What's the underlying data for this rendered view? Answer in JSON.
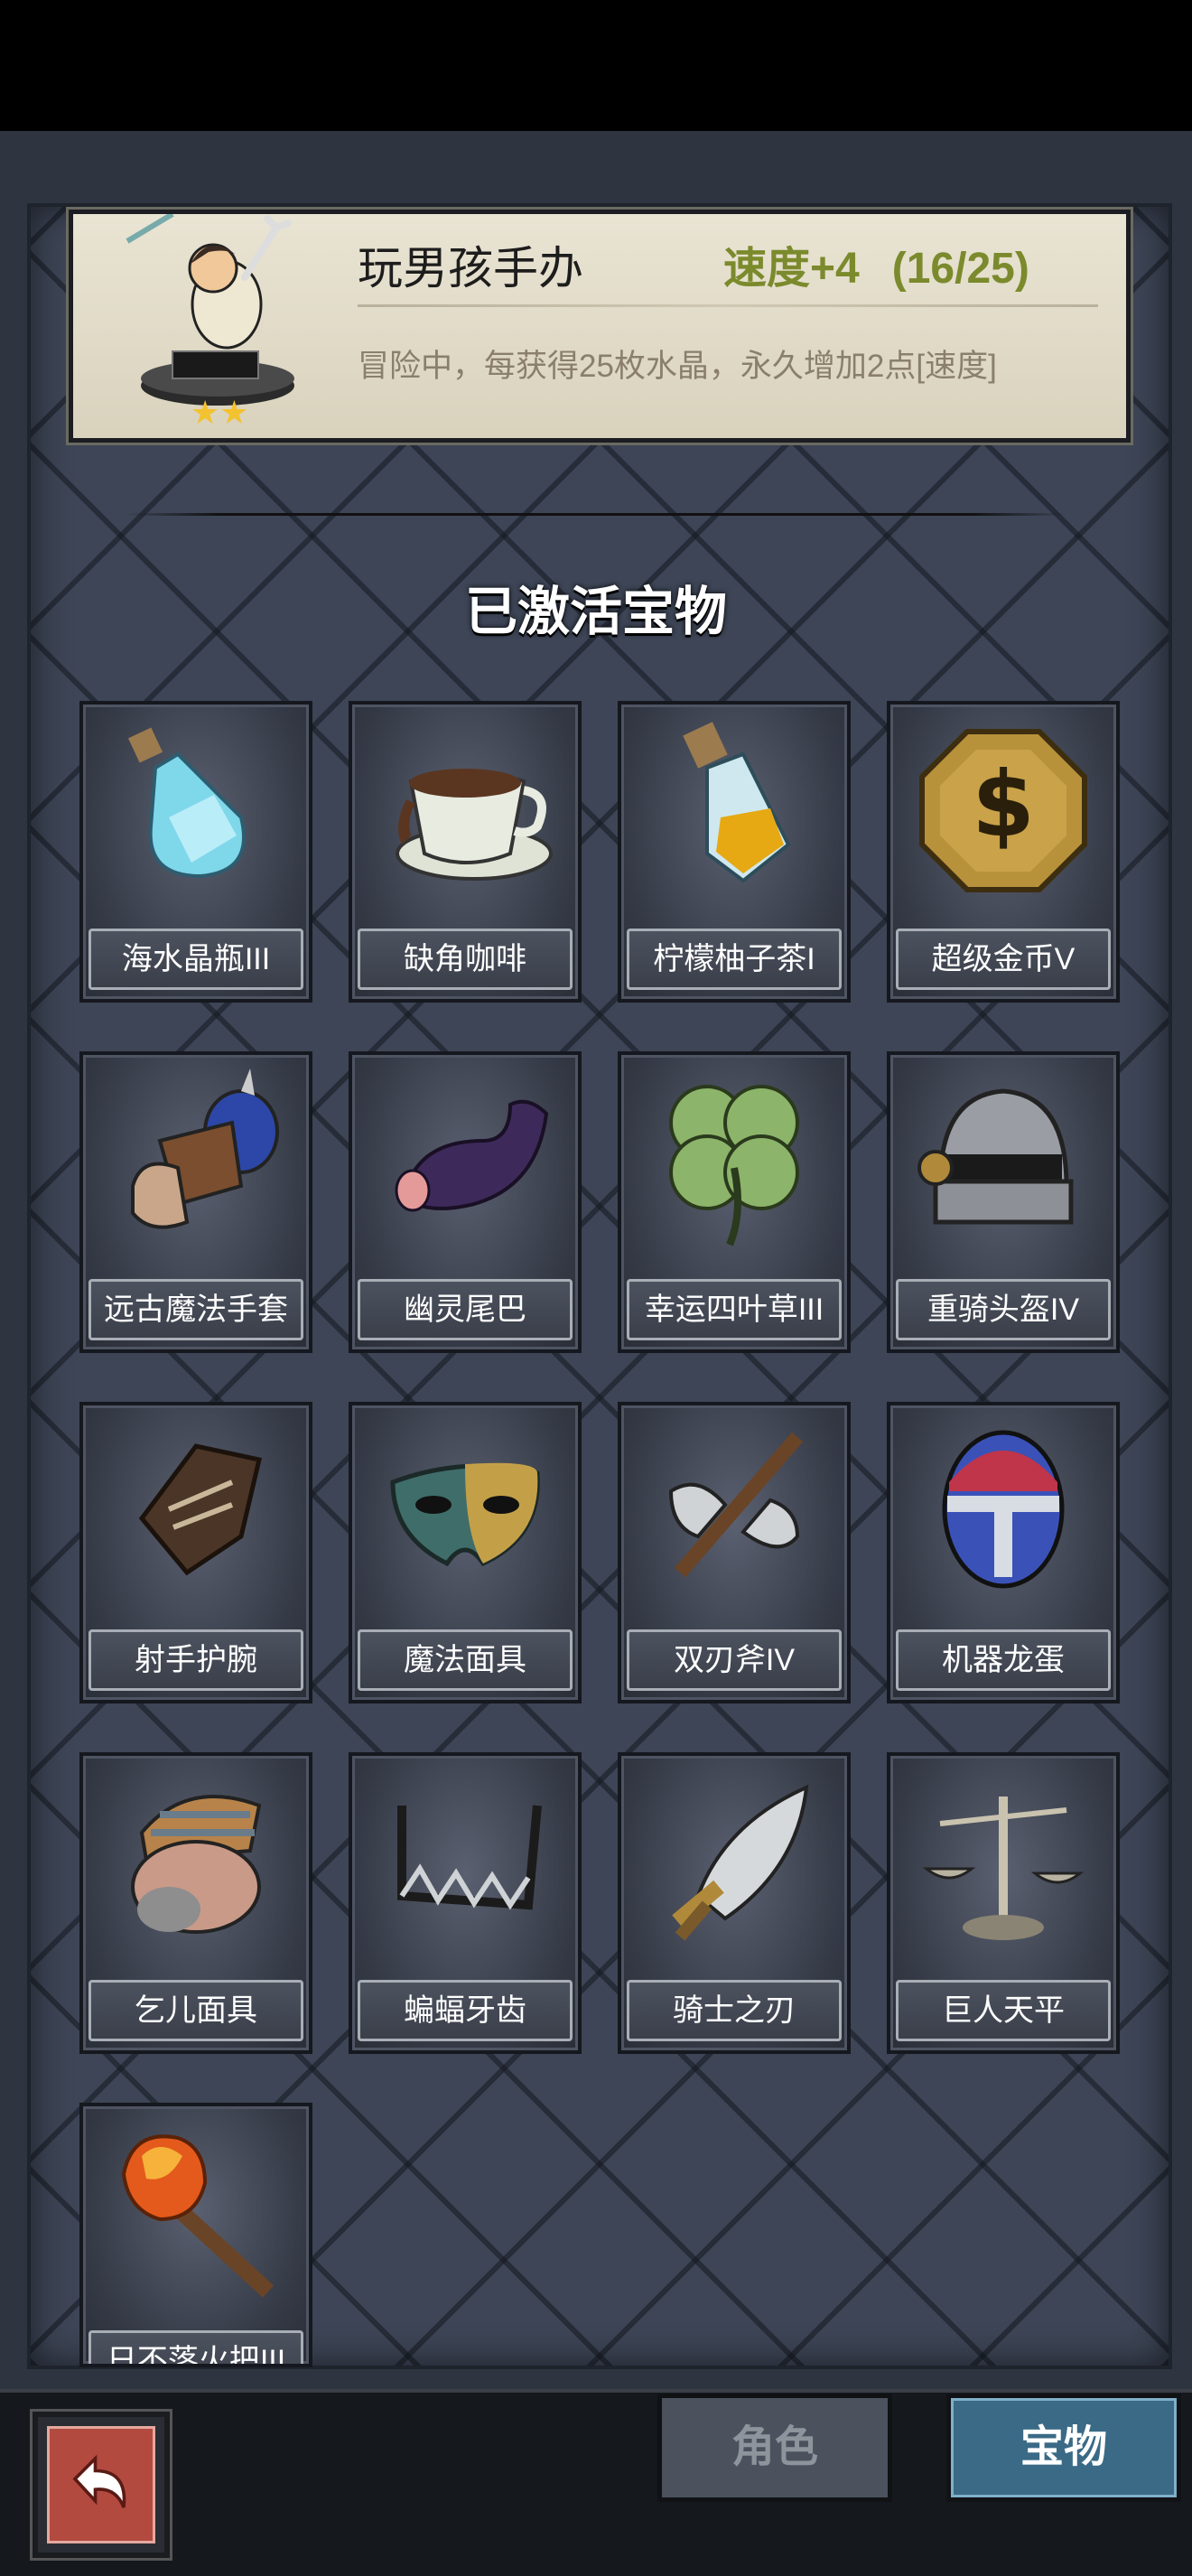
{
  "featured": {
    "name": "玩男孩手办",
    "bonus": "速度+4",
    "progress": "(16/25)",
    "description": "冒险中，每获得25枚水晶，永久增加2点[速度]",
    "stars": 2
  },
  "section_title": "已激活宝物",
  "treasures": [
    {
      "name": "海水晶瓶III",
      "icon": "crystal-bottle-icon"
    },
    {
      "name": "缺角咖啡",
      "icon": "chipped-coffee-icon"
    },
    {
      "name": "柠檬柚子茶I",
      "icon": "lemon-tea-icon"
    },
    {
      "name": "超级金币V",
      "icon": "gold-coin-icon"
    },
    {
      "name": "远古魔法手套",
      "icon": "magic-glove-icon"
    },
    {
      "name": "幽灵尾巴",
      "icon": "ghost-tail-icon"
    },
    {
      "name": "幸运四叶草III",
      "icon": "clover-icon"
    },
    {
      "name": "重骑头盔IV",
      "icon": "helmet-icon"
    },
    {
      "name": "射手护腕",
      "icon": "bracer-icon"
    },
    {
      "name": "魔法面具",
      "icon": "magic-mask-icon"
    },
    {
      "name": "双刃斧IV",
      "icon": "double-axe-icon"
    },
    {
      "name": "机器龙蛋",
      "icon": "robot-egg-icon"
    },
    {
      "name": "乞儿面具",
      "icon": "beggar-mask-icon"
    },
    {
      "name": "蝙蝠牙齿",
      "icon": "bat-teeth-icon"
    },
    {
      "name": "骑士之刃",
      "icon": "knight-blade-icon"
    },
    {
      "name": "巨人天平",
      "icon": "giant-scale-icon"
    },
    {
      "name": "日不落火把III",
      "icon": "torch-icon"
    }
  ],
  "tabs": {
    "role": "角色",
    "treasure": "宝物"
  }
}
